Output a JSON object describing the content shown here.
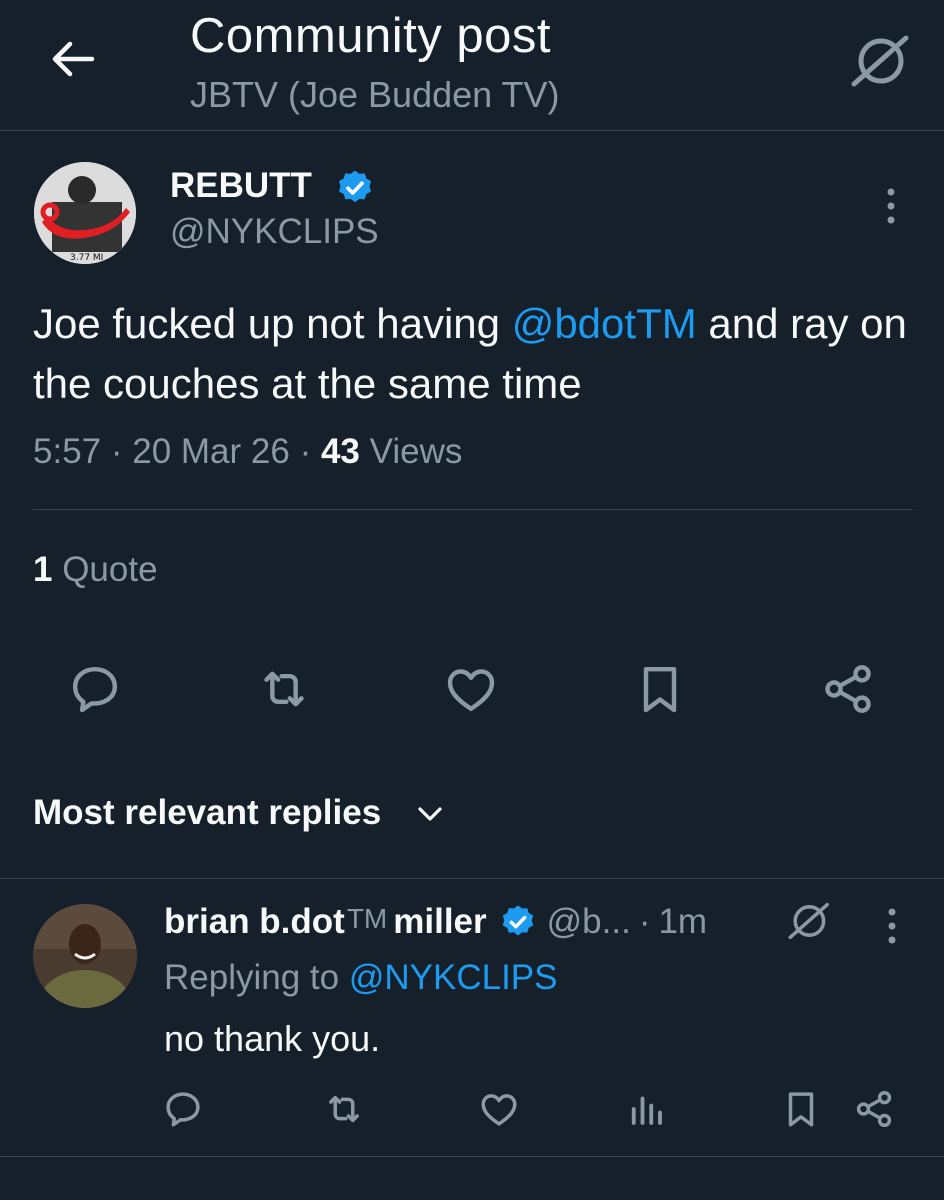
{
  "header": {
    "title": "Community post",
    "subtitle": "JBTV (Joe Budden TV)"
  },
  "post": {
    "author_name": "REBUTT",
    "author_handle": "@NYKCLIPS",
    "avatar_caption": "3.77 MI",
    "text_before": "Joe fucked up not having ",
    "mention": "@bdotTM",
    "text_after": " and ray on the couches at the same time",
    "time": "5:57",
    "date": "20 Mar 26",
    "views_count": "43",
    "views_label": "Views",
    "quote_count": "1",
    "quote_label": "Quote",
    "separator": "·"
  },
  "replies_sort": {
    "label": "Most relevant replies"
  },
  "reply": {
    "name_part1": "brian b.dot",
    "name_tm": "TM",
    "name_part2": " miller",
    "handle": "@b...",
    "time": "1m",
    "separator": "·",
    "replying_prefix": "Replying to ",
    "replying_to": "@NYKCLIPS",
    "text": "no thank you."
  },
  "colors": {
    "background": "#15202b",
    "text": "#f7f9f9",
    "muted": "#8b98a5",
    "accent": "#1d9bf0",
    "divider": "#38444d"
  },
  "icons": {
    "back": "arrow-left-icon",
    "grok": "grok-icon",
    "verified": "verified-badge-icon",
    "more": "more-vertical-icon",
    "reply": "reply-icon",
    "repost": "repost-icon",
    "like": "like-icon",
    "bookmark": "bookmark-icon",
    "share": "share-icon",
    "views": "views-icon",
    "chevron": "chevron-down-icon"
  }
}
